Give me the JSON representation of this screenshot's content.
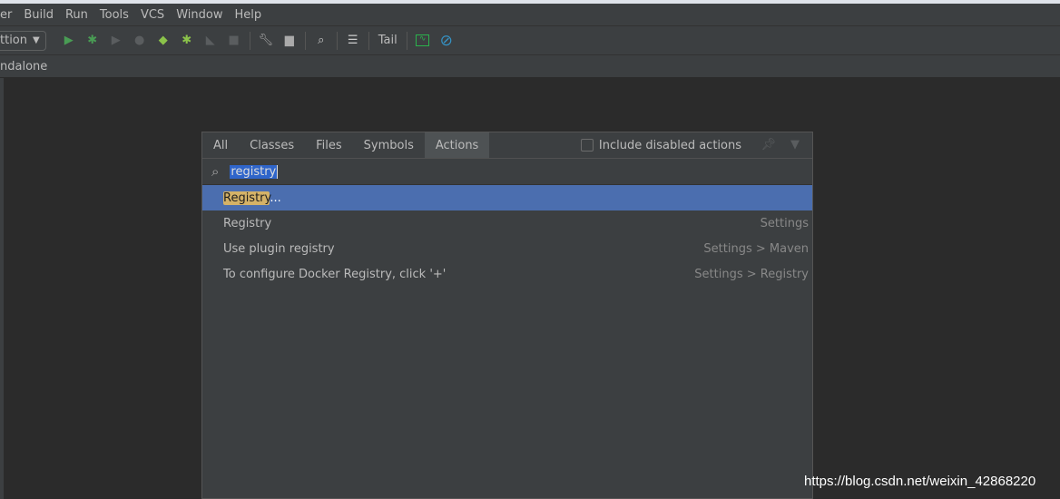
{
  "menu": [
    "er",
    "Build",
    "Run",
    "Tools",
    "VCS",
    "Window",
    "Help"
  ],
  "toolbar": {
    "run_config": "ttion",
    "tail_label": "Tail",
    "icons": [
      "run-icon",
      "debug-icon",
      "run-coverage-icon",
      "profile-icon",
      "jrebel-run-icon",
      "jrebel-debug-icon",
      "attach-icon",
      "stop-icon",
      "wrench-icon",
      "project-structure-icon",
      "search-icon",
      "services-icon",
      "tail-icon",
      "activity-monitor-icon",
      "no-sign-icon"
    ]
  },
  "navbar": {
    "crumb": "ndalone"
  },
  "popup": {
    "tabs": [
      "All",
      "Classes",
      "Files",
      "Symbols",
      "Actions"
    ],
    "active_tab": "Actions",
    "include_disabled": "Include disabled actions",
    "include_disabled_checked": false,
    "search_value": "registry",
    "results": [
      {
        "name_hl": "Registry",
        "name_rest": "...",
        "location": ""
      },
      {
        "name": "Registry",
        "location": "Settings"
      },
      {
        "name": "Use plugin registry",
        "location": "Settings > Maven"
      },
      {
        "name": "To configure Docker Registry, click '+'",
        "location": "Settings > Registry"
      }
    ],
    "colors": {
      "selection": "#4b6eaf",
      "match_highlight": "#d4b267"
    }
  },
  "watermark": "https://blog.csdn.net/weixin_42868220"
}
